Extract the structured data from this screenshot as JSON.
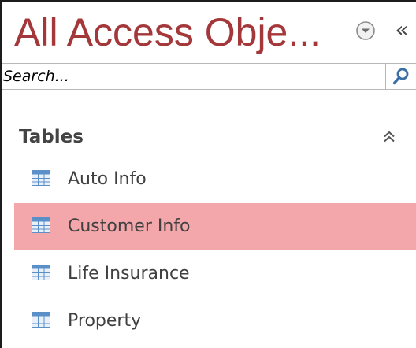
{
  "navigation_pane": {
    "title": "All Access Obje...",
    "menu_icon": "circle-chevron-down-icon",
    "collapse_label": "«",
    "collapse_icon": "double-chevron-left-icon"
  },
  "search": {
    "placeholder": "Search...",
    "value": "",
    "icon": "search-icon"
  },
  "group": {
    "label": "Tables",
    "collapse_icon": "double-chevron-up-icon"
  },
  "items": [
    {
      "label": "Auto Info",
      "icon": "table-icon",
      "selected": false
    },
    {
      "label": "Customer Info",
      "icon": "table-icon",
      "selected": true
    },
    {
      "label": "Life Insurance",
      "icon": "table-icon",
      "selected": false
    },
    {
      "label": "Property",
      "icon": "table-icon",
      "selected": false
    }
  ],
  "colors": {
    "title": "#a4373a",
    "selected_row": "#f4a7ab",
    "search_icon": "#3a6ea5",
    "table_icon_header": "#5b8fc7",
    "table_icon_cells": "#eaf0f8"
  }
}
